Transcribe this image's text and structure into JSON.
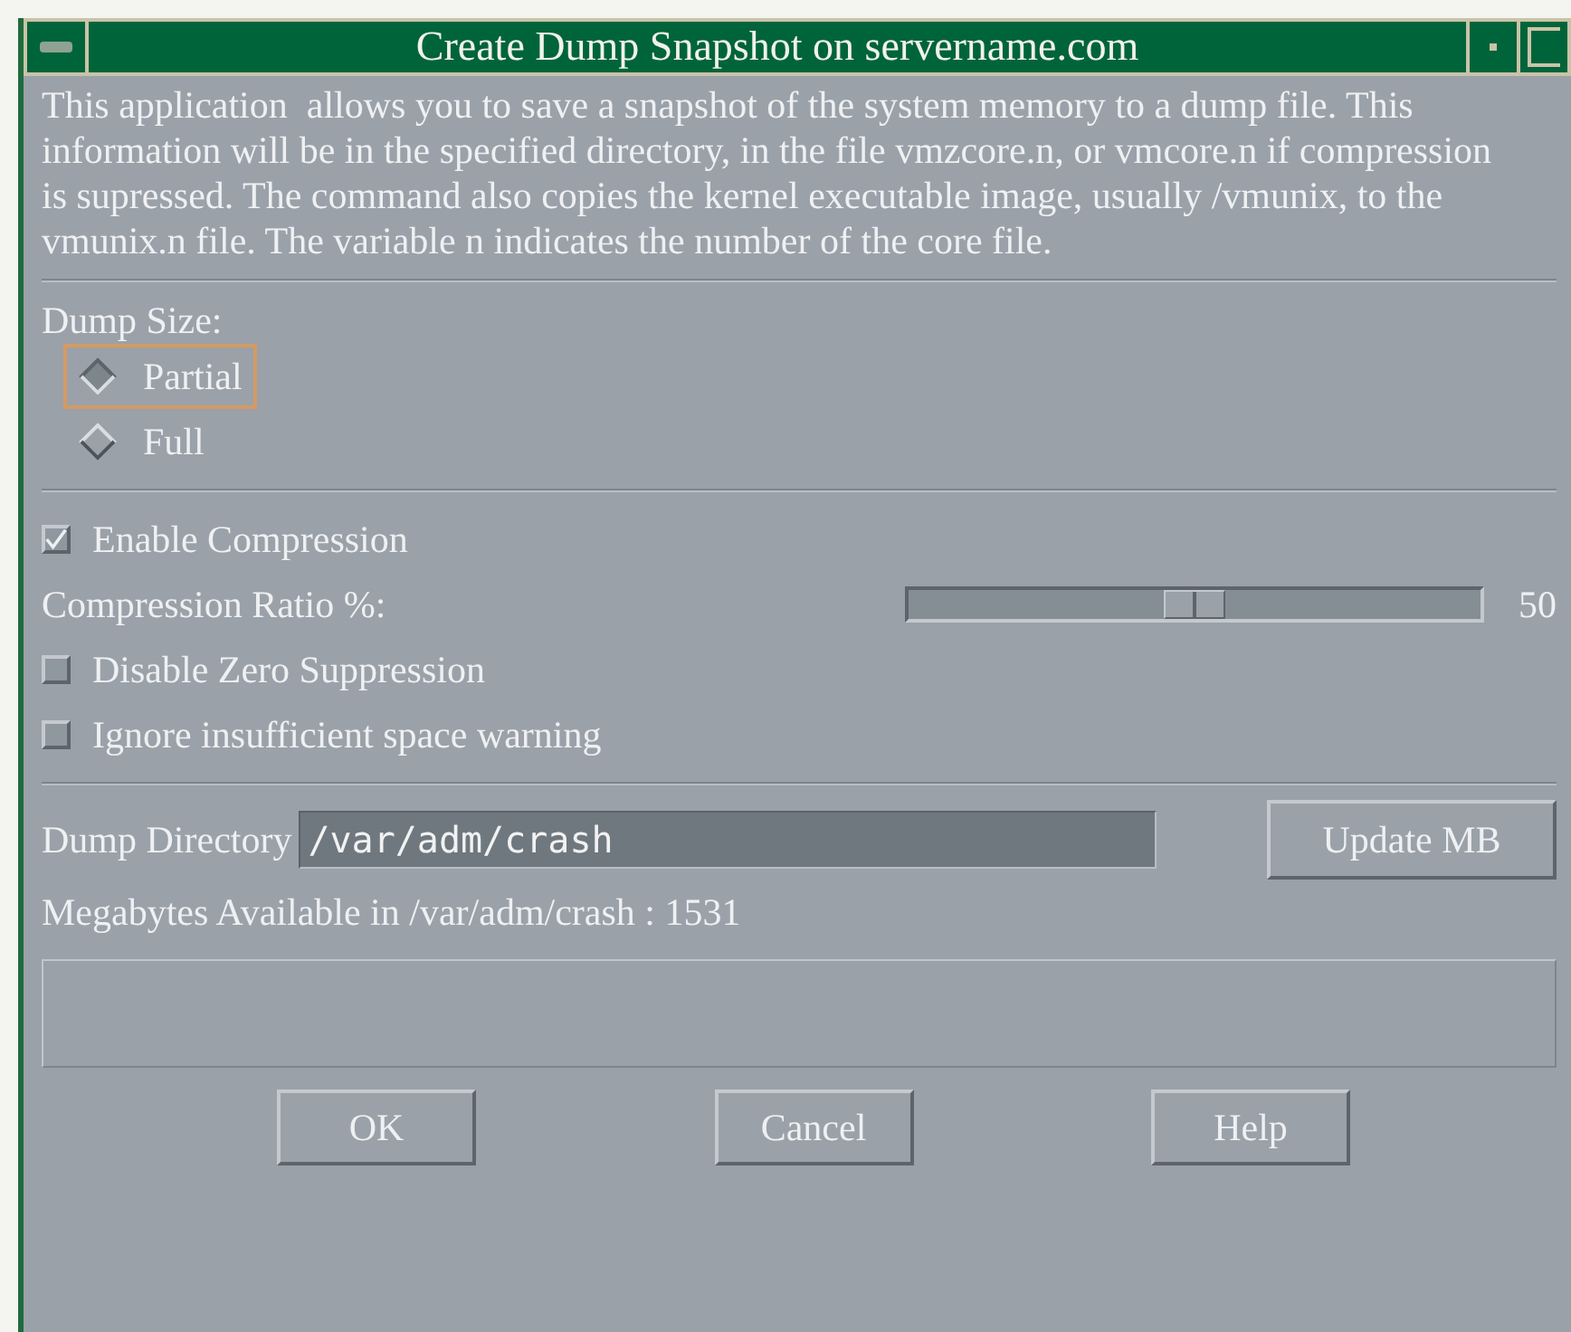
{
  "window": {
    "title": "Create Dump Snapshot on servername.com"
  },
  "description": "This application  allows you to save a snapshot of the system memory to a dump file. This information will be in the specified directory, in the file vmzcore.n, or vmcore.n if compression is supressed. The command also copies the kernel executable image, usually /vmunix, to the vmunix.n file. The variable n indicates the number of the core file.",
  "dump_size": {
    "label": "Dump Size:",
    "options": [
      {
        "label": "Partial",
        "selected": true
      },
      {
        "label": "Full",
        "selected": false
      }
    ]
  },
  "enable_compression": {
    "label": "Enable Compression",
    "checked": true
  },
  "compression_ratio": {
    "label": "Compression Ratio %:",
    "level": 0.5,
    "reading": "50"
  },
  "options": [
    {
      "label": "Disable Zero Suppression",
      "checked": false
    },
    {
      "label": "Ignore insufficient space warning",
      "checked": false
    }
  ],
  "dump_directory": {
    "label": "Dump Directory",
    "value": "/var/adm/crash",
    "button": "Update MB"
  },
  "available": "Megabytes Available in /var/adm/crash : 1531",
  "buttons": [
    "OK",
    "Cancel",
    "Help"
  ]
}
